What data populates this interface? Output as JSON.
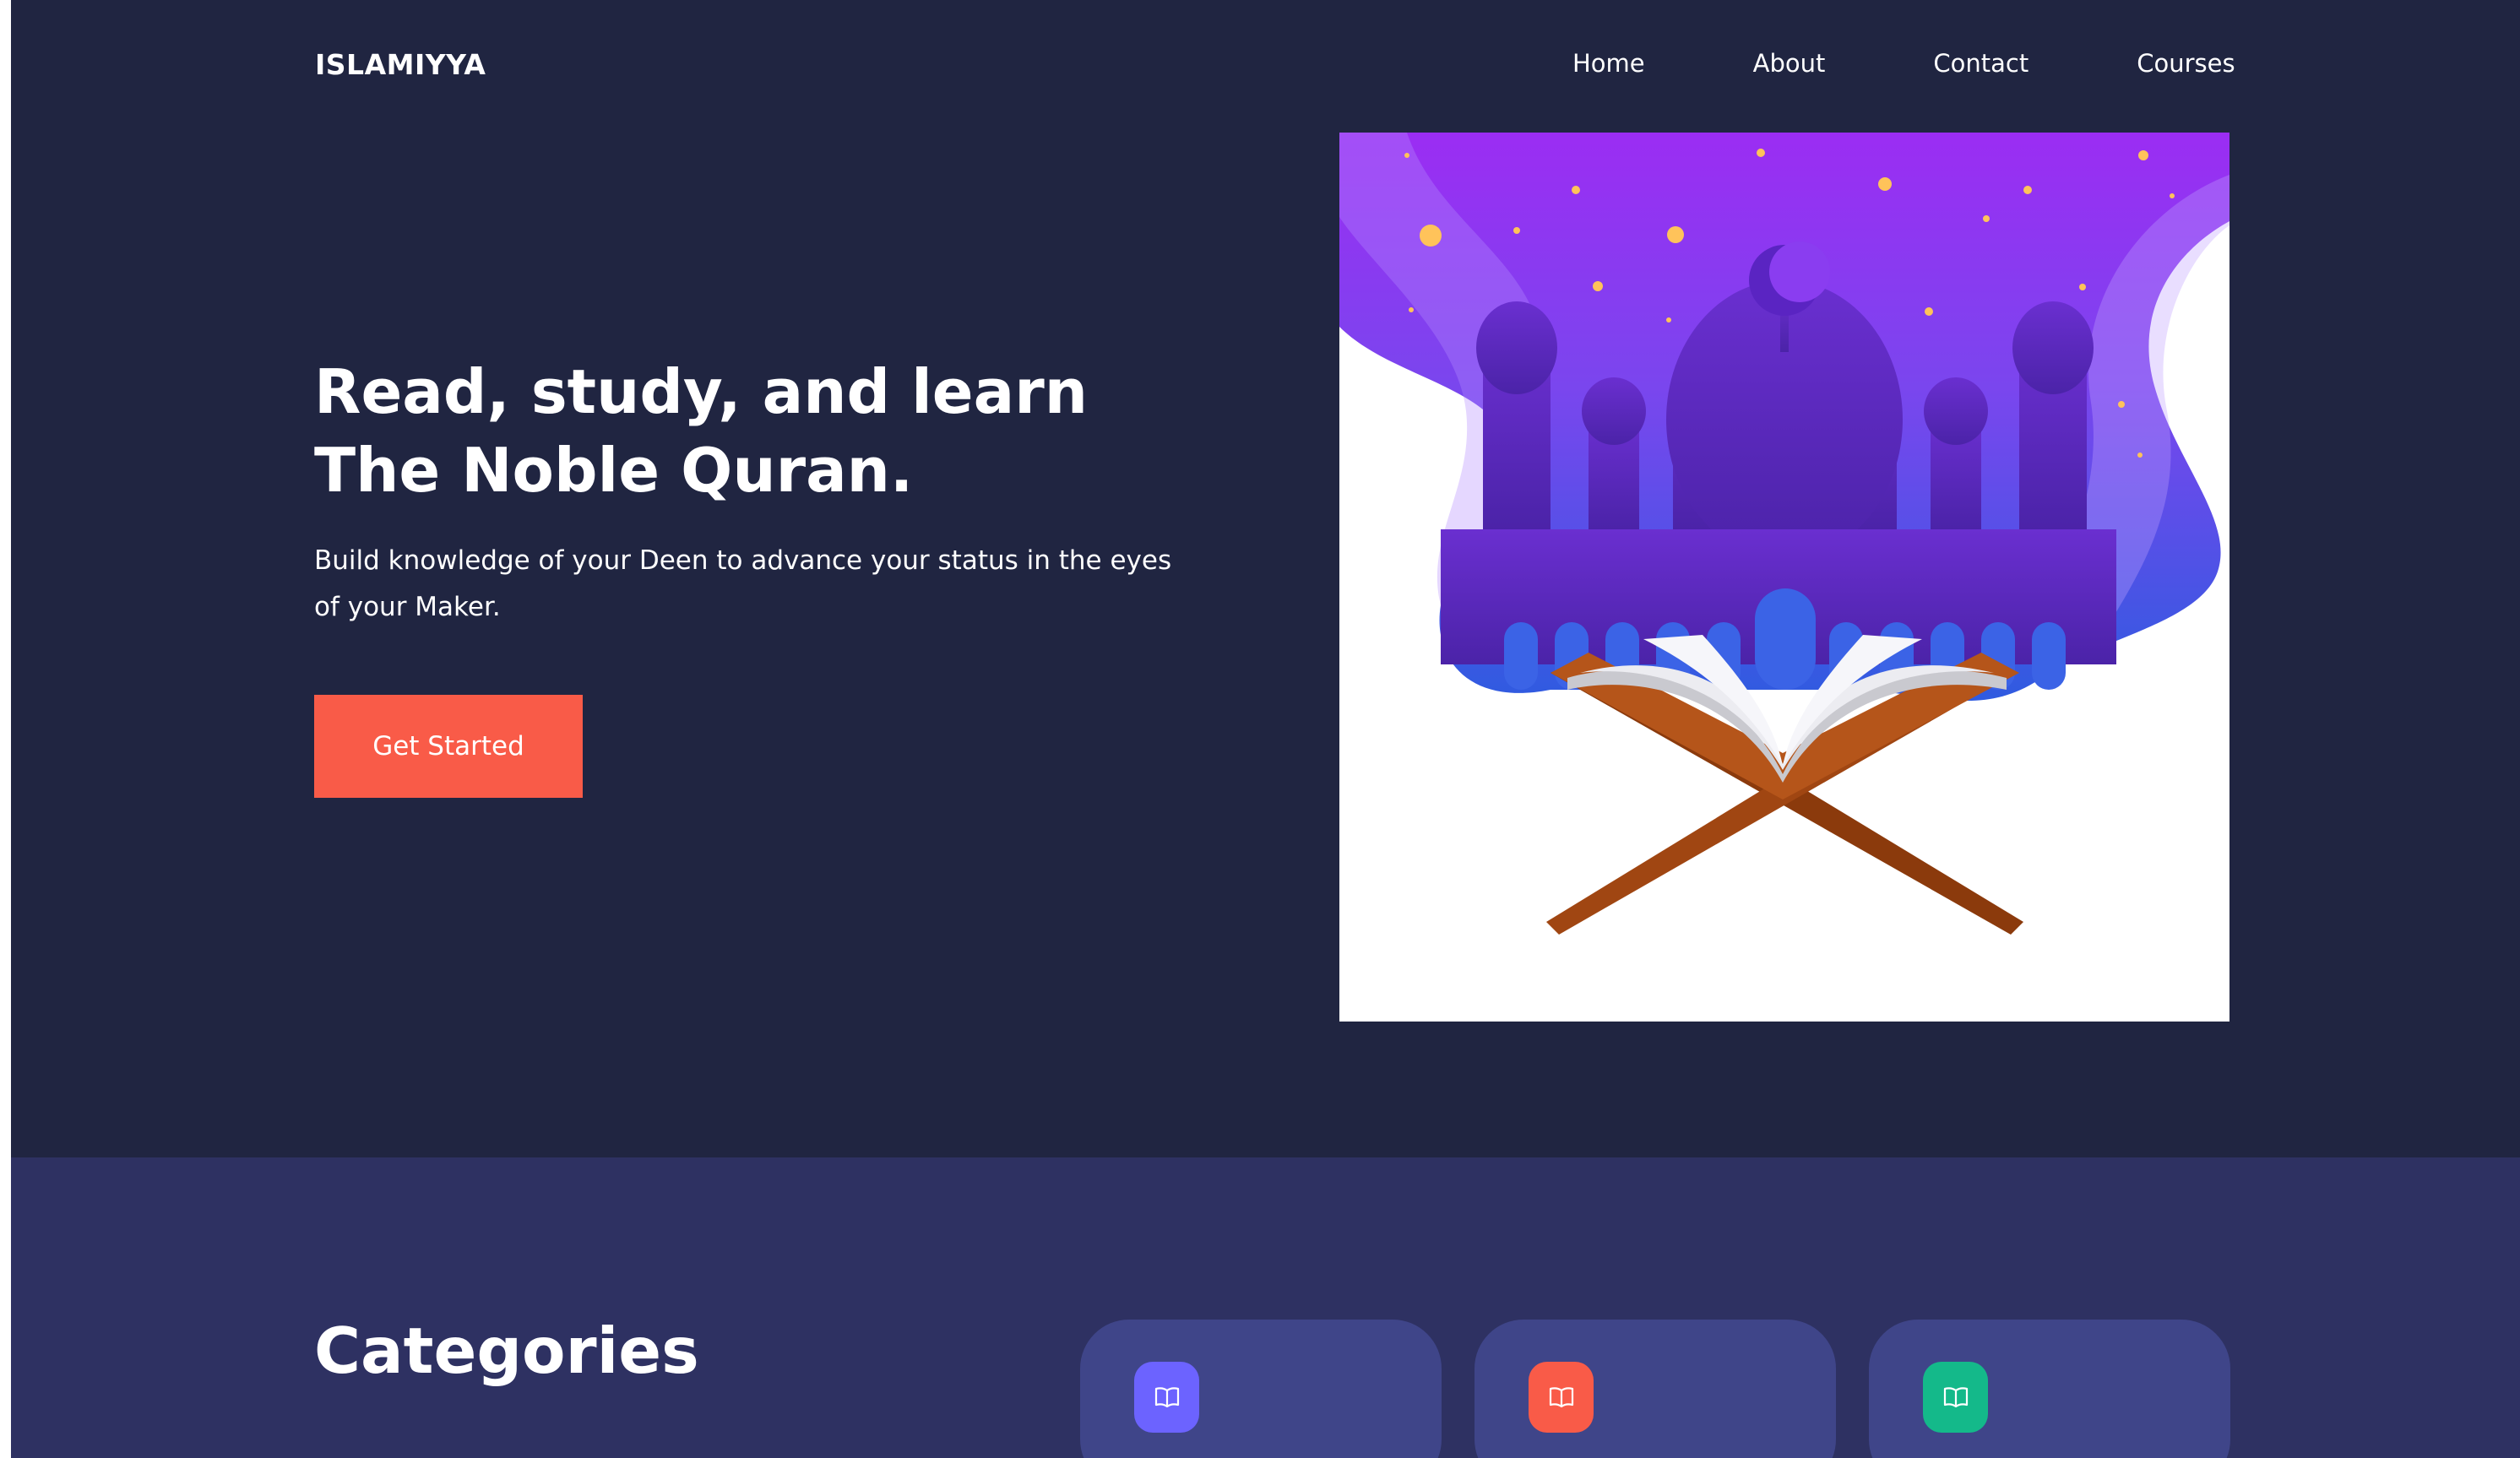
{
  "brand": {
    "logo": "ISLAMIYYA"
  },
  "nav": {
    "items": [
      {
        "label": "Home"
      },
      {
        "label": "About"
      },
      {
        "label": "Contact"
      },
      {
        "label": "Courses"
      }
    ]
  },
  "hero": {
    "title_line1": "Read, study, and learn",
    "title_line2": "The Noble Quran.",
    "subtitle_line1": "Build knowledge of your Deen to advance your status in the eyes",
    "subtitle_line2": "of your Maker.",
    "cta_label": "Get Started",
    "illustration": "mosque-and-quran-illustration"
  },
  "categories": {
    "title": "Categories",
    "cards": [
      {
        "icon": "book-open-icon",
        "color": "#6c63ff"
      },
      {
        "icon": "book-open-icon",
        "color": "#f95b48"
      },
      {
        "icon": "book-open-icon",
        "color": "#14b98a"
      }
    ]
  },
  "colors": {
    "background": "#202541",
    "accent": "#f95b48",
    "section": "#2e3162",
    "card": "#3f4589"
  }
}
